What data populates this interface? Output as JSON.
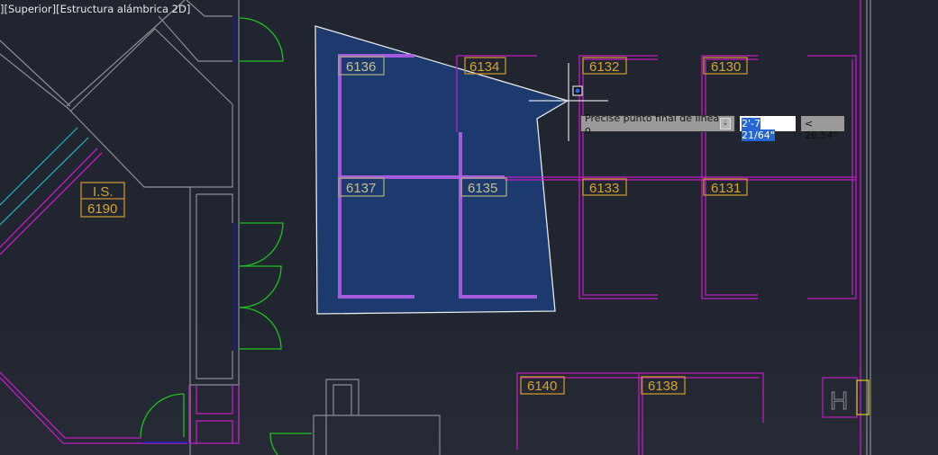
{
  "viewport": {
    "label": "][Superior][Estructura alámbrica 2D]"
  },
  "rooms": {
    "r6136": "6136",
    "r6134": "6134",
    "r6132": "6132",
    "r6130": "6130",
    "r6137": "6137",
    "r6135": "6135",
    "r6133": "6133",
    "r6131": "6131",
    "r6140": "6140",
    "r6138": "6138",
    "is_name": "I.S.",
    "r6190": "6190"
  },
  "symbol": {
    "h": "H"
  },
  "dynamic_input": {
    "prompt": "Precise punto final de línea o",
    "prompt_icon": "arrow-down-icon",
    "distance": "2'-7 21/64\"",
    "angle": "< 26.54°"
  },
  "colors": {
    "background": "#212530",
    "walls": "#c21cc4",
    "labels": "#d6a62a",
    "selection": "#1c3a6e",
    "doors": "#1ec21e"
  }
}
